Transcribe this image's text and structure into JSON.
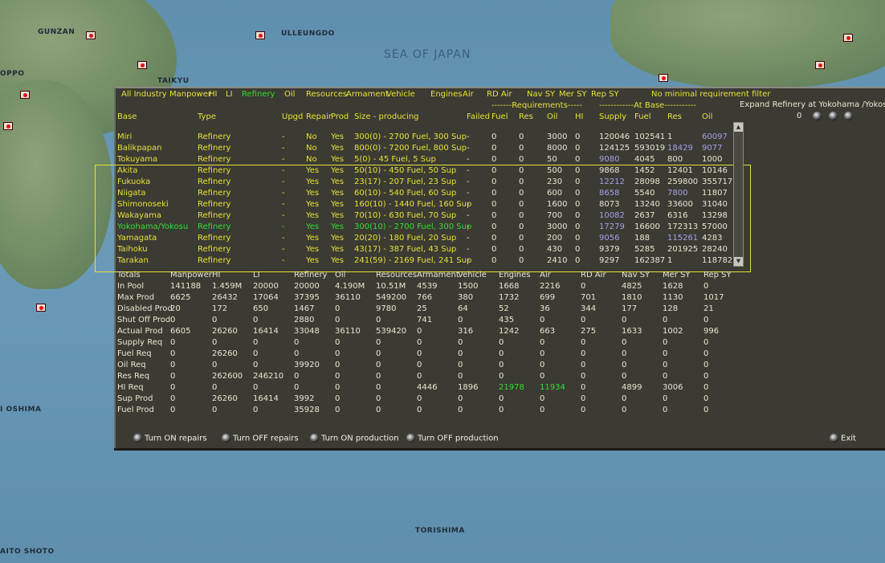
{
  "map": {
    "labels": [
      "GUNZAN",
      "ULLEUNGDO",
      "TAIKYU",
      "OPPO",
      "I OSHIMA",
      "TORISHIMA",
      "AITO SHOTO"
    ],
    "sea": "SEA OF JAPAN"
  },
  "colors": {
    "yellow": "#e6e23a",
    "green": "#33dd33",
    "purple": "#a6a0ea",
    "panel": "#3b3a33"
  },
  "nav": {
    "items": [
      "All Industry",
      "Manpower",
      "HI",
      "LI",
      "Refinery",
      "Oil",
      "Resources",
      "Armament",
      "Vehicle",
      "Engines",
      "Air",
      "RD Air",
      "Nav SY",
      "Mer SY",
      "Rep SY"
    ],
    "active": "Refinery",
    "filter": "No minimal requirement filter"
  },
  "groups": {
    "requirements": "-------Requirements-----",
    "atbase": "------------At Base-----------"
  },
  "expand": {
    "label": "Expand Refinery at Yokohama /Yokosu",
    "value": "0"
  },
  "headers": [
    "Base",
    "Type",
    "Upgd",
    "Repair",
    "Prod",
    "Size - producing",
    "Failed",
    "Fuel",
    "Res",
    "Oil",
    "HI",
    "Supply",
    "Fuel",
    "Res",
    "Oil"
  ],
  "rows": [
    {
      "c": [
        "Miri",
        "Refinery",
        "-",
        "No",
        "Yes",
        "300(0) - 2700 Fuel, 300 Sup",
        "-",
        "0",
        "0",
        "3000",
        "0",
        "120046",
        "102541",
        "1",
        "60097"
      ],
      "p": [
        14
      ]
    },
    {
      "c": [
        "Balikpapan",
        "Refinery",
        "-",
        "No",
        "Yes",
        "800(0) - 7200 Fuel, 800 Sup",
        "-",
        "0",
        "0",
        "8000",
        "0",
        "124125",
        "593019",
        "18429",
        "9077"
      ],
      "p": [
        13,
        14
      ]
    },
    {
      "c": [
        "Tokuyama",
        "Refinery",
        "-",
        "No",
        "Yes",
        "5(0) - 45 Fuel, 5 Sup",
        "-",
        "0",
        "0",
        "50",
        "0",
        "9080",
        "4045",
        "800",
        "1000"
      ],
      "p": [
        11
      ]
    },
    {
      "c": [
        "Akita",
        "Refinery",
        "-",
        "Yes",
        "Yes",
        "50(10) - 450 Fuel, 50 Sup",
        "-",
        "0",
        "0",
        "500",
        "0",
        "9868",
        "1452",
        "12401",
        "10146"
      ],
      "p": []
    },
    {
      "c": [
        "Fukuoka",
        "Refinery",
        "-",
        "Yes",
        "Yes",
        "23(17) - 207 Fuel, 23 Sup",
        "-",
        "0",
        "0",
        "230",
        "0",
        "12212",
        "28098",
        "259800",
        "355717"
      ],
      "p": [
        11
      ]
    },
    {
      "c": [
        "Niigata",
        "Refinery",
        "-",
        "Yes",
        "Yes",
        "60(10) - 540 Fuel, 60 Sup",
        "-",
        "0",
        "0",
        "600",
        "0",
        "8658",
        "5540",
        "7800",
        "11807"
      ],
      "p": [
        11,
        13
      ]
    },
    {
      "c": [
        "Shimonoseki",
        "Refinery",
        "-",
        "Yes",
        "Yes",
        "160(10) - 1440 Fuel, 160 Sup",
        "-",
        "0",
        "0",
        "1600",
        "0",
        "8073",
        "13240",
        "33600",
        "31040"
      ],
      "p": []
    },
    {
      "c": [
        "Wakayama",
        "Refinery",
        "-",
        "Yes",
        "Yes",
        "70(10) - 630 Fuel, 70 Sup",
        "-",
        "0",
        "0",
        "700",
        "0",
        "10082",
        "2637",
        "6316",
        "13298"
      ],
      "p": [
        11
      ]
    },
    {
      "c": [
        "Yokohama/Yokosu",
        "Refinery",
        "-",
        "Yes",
        "Yes",
        "300(10) - 2700 Fuel, 300 Sup",
        "-",
        "0",
        "0",
        "3000",
        "0",
        "17279",
        "16600",
        "172313",
        "57000"
      ],
      "p": [
        11
      ],
      "selected": true
    },
    {
      "c": [
        "Yamagata",
        "Refinery",
        "-",
        "Yes",
        "Yes",
        "20(20) - 180 Fuel, 20 Sup",
        "-",
        "0",
        "0",
        "200",
        "0",
        "9056",
        "188",
        "115261",
        "4283"
      ],
      "p": [
        11,
        13
      ]
    },
    {
      "c": [
        "Taihoku",
        "Refinery",
        "-",
        "Yes",
        "Yes",
        "43(17) - 387 Fuel, 43 Sup",
        "-",
        "0",
        "0",
        "430",
        "0",
        "9379",
        "5285",
        "201925",
        "28240"
      ],
      "p": []
    },
    {
      "c": [
        "Tarakan",
        "Refinery",
        "-",
        "Yes",
        "Yes",
        "241(59) - 2169 Fuel, 241 Sup",
        "-",
        "0",
        "0",
        "2410",
        "0",
        "9297",
        "162387",
        "1",
        "118782"
      ],
      "p": []
    }
  ],
  "totals": {
    "headers": [
      "Totals",
      "Manpower",
      "HI",
      "LI",
      "Refinery",
      "Oil",
      "Resources",
      "Armament",
      "Vehicle",
      "Engines",
      "Air",
      "RD Air",
      "Nav SY",
      "Mer SY",
      "Rep SY"
    ],
    "rows": [
      {
        "c": [
          "In Pool",
          "141188",
          "1.459M",
          "20000",
          "20000",
          "4.190M",
          "10.51M",
          "4539",
          "1500",
          "1668",
          "2216",
          "0",
          "4825",
          "1628",
          "0"
        ]
      },
      {
        "c": [
          "Max Prod",
          "6625",
          "26432",
          "17064",
          "37395",
          "36110",
          "549200",
          "766",
          "380",
          "1732",
          "699",
          "701",
          "1810",
          "1130",
          "1017"
        ]
      },
      {
        "c": [
          "Disabled Prod",
          "20",
          "172",
          "650",
          "1467",
          "0",
          "9780",
          "25",
          "64",
          "52",
          "36",
          "344",
          "177",
          "128",
          "21"
        ]
      },
      {
        "c": [
          "Shut Off Prod",
          "0",
          "0",
          "0",
          "2880",
          "0",
          "0",
          "741",
          "0",
          "435",
          "0",
          "0",
          "0",
          "0",
          "0"
        ]
      },
      {
        "c": [
          "Actual Prod",
          "6605",
          "26260",
          "16414",
          "33048",
          "36110",
          "539420",
          "0",
          "316",
          "1242",
          "663",
          "275",
          "1633",
          "1002",
          "996"
        ]
      },
      {
        "c": [
          "Supply Req",
          "0",
          "0",
          "0",
          "0",
          "0",
          "0",
          "0",
          "0",
          "0",
          "0",
          "0",
          "0",
          "0",
          "0"
        ]
      },
      {
        "c": [
          "Fuel Req",
          "0",
          "26260",
          "0",
          "0",
          "0",
          "0",
          "0",
          "0",
          "0",
          "0",
          "0",
          "0",
          "0",
          "0"
        ]
      },
      {
        "c": [
          "Oil Req",
          "0",
          "0",
          "0",
          "39920",
          "0",
          "0",
          "0",
          "0",
          "0",
          "0",
          "0",
          "0",
          "0",
          "0"
        ]
      },
      {
        "c": [
          "Res Req",
          "0",
          "262600",
          "246210",
          "0",
          "0",
          "0",
          "0",
          "0",
          "0",
          "0",
          "0",
          "0",
          "0",
          "0"
        ]
      },
      {
        "c": [
          "HI Req",
          "0",
          "0",
          "0",
          "0",
          "0",
          "0",
          "4446",
          "1896",
          "21978",
          "11934",
          "0",
          "4899",
          "3006",
          "0"
        ],
        "g": [
          9,
          10
        ]
      },
      {
        "c": [
          "Sup Prod",
          "0",
          "26260",
          "16414",
          "3992",
          "0",
          "0",
          "0",
          "0",
          "0",
          "0",
          "0",
          "0",
          "0",
          "0"
        ]
      },
      {
        "c": [
          "Fuel Prod",
          "0",
          "0",
          "0",
          "35928",
          "0",
          "0",
          "0",
          "0",
          "0",
          "0",
          "0",
          "0",
          "0",
          "0"
        ]
      }
    ]
  },
  "buttons": {
    "turn_on_repairs": "Turn ON repairs",
    "turn_off_repairs": "Turn OFF repairs",
    "turn_on_production": "Turn ON production",
    "turn_off_production": "Turn OFF production",
    "exit": "Exit"
  }
}
